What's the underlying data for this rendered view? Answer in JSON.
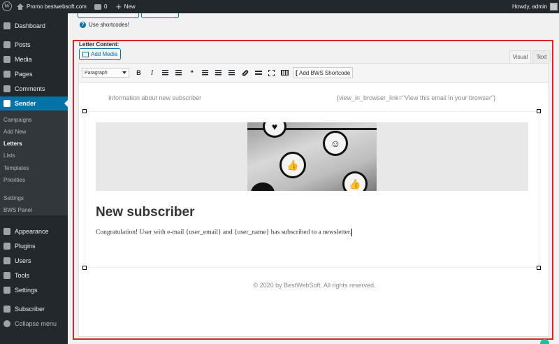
{
  "admin_bar": {
    "site_name": "Promo bestwebsoft.com",
    "comments_count": "0",
    "new_label": "New",
    "howdy": "Howdy, admin"
  },
  "sidebar": {
    "items": [
      {
        "label": "Dashboard",
        "icon": "dashboard-icon"
      },
      {
        "label": "Posts",
        "icon": "pin-icon"
      },
      {
        "label": "Media",
        "icon": "media-icon"
      },
      {
        "label": "Pages",
        "icon": "pages-icon"
      },
      {
        "label": "Comments",
        "icon": "comments-icon"
      },
      {
        "label": "Sender",
        "icon": "send-icon"
      },
      {
        "label": "Appearance",
        "icon": "brush-icon"
      },
      {
        "label": "Plugins",
        "icon": "plug-icon"
      },
      {
        "label": "Users",
        "icon": "users-icon"
      },
      {
        "label": "Tools",
        "icon": "wrench-icon"
      },
      {
        "label": "Settings",
        "icon": "settings-icon"
      },
      {
        "label": "Subscriber",
        "icon": "subscriber-icon"
      },
      {
        "label": "Collapse menu",
        "icon": "collapse-icon"
      }
    ],
    "submenu": [
      "Campaigns",
      "Add New",
      "Letters",
      "Lists",
      "Templates",
      "Priorities",
      "Settings",
      "BWS Panel"
    ]
  },
  "page": {
    "shortcode_note": "Use shortcodes!",
    "letter_content_label": "Letter Content:",
    "add_media": "Add Media",
    "tab_visual": "Visual",
    "tab_text": "Text"
  },
  "toolbar": {
    "format_value": "Paragraph",
    "bold": "B",
    "italic": "I",
    "blockquote": "❝",
    "bws_shortcode": "Add BWS Shortcode"
  },
  "letter": {
    "preheader_left": "Information about new subscriber",
    "preheader_right": "{view_in_browser_link=\"View this email in your browser\"}",
    "headline": "New subscriber",
    "body": "Congratulation! User with e-mail {user_email} and {user_name} has subscribed to a newsletter.",
    "footer": "© 2020 by BestWebSoft. All rights reserved."
  },
  "colors": {
    "admin_dark": "#23282d",
    "accent_blue": "#0073aa",
    "highlight_red": "#e01f26"
  }
}
